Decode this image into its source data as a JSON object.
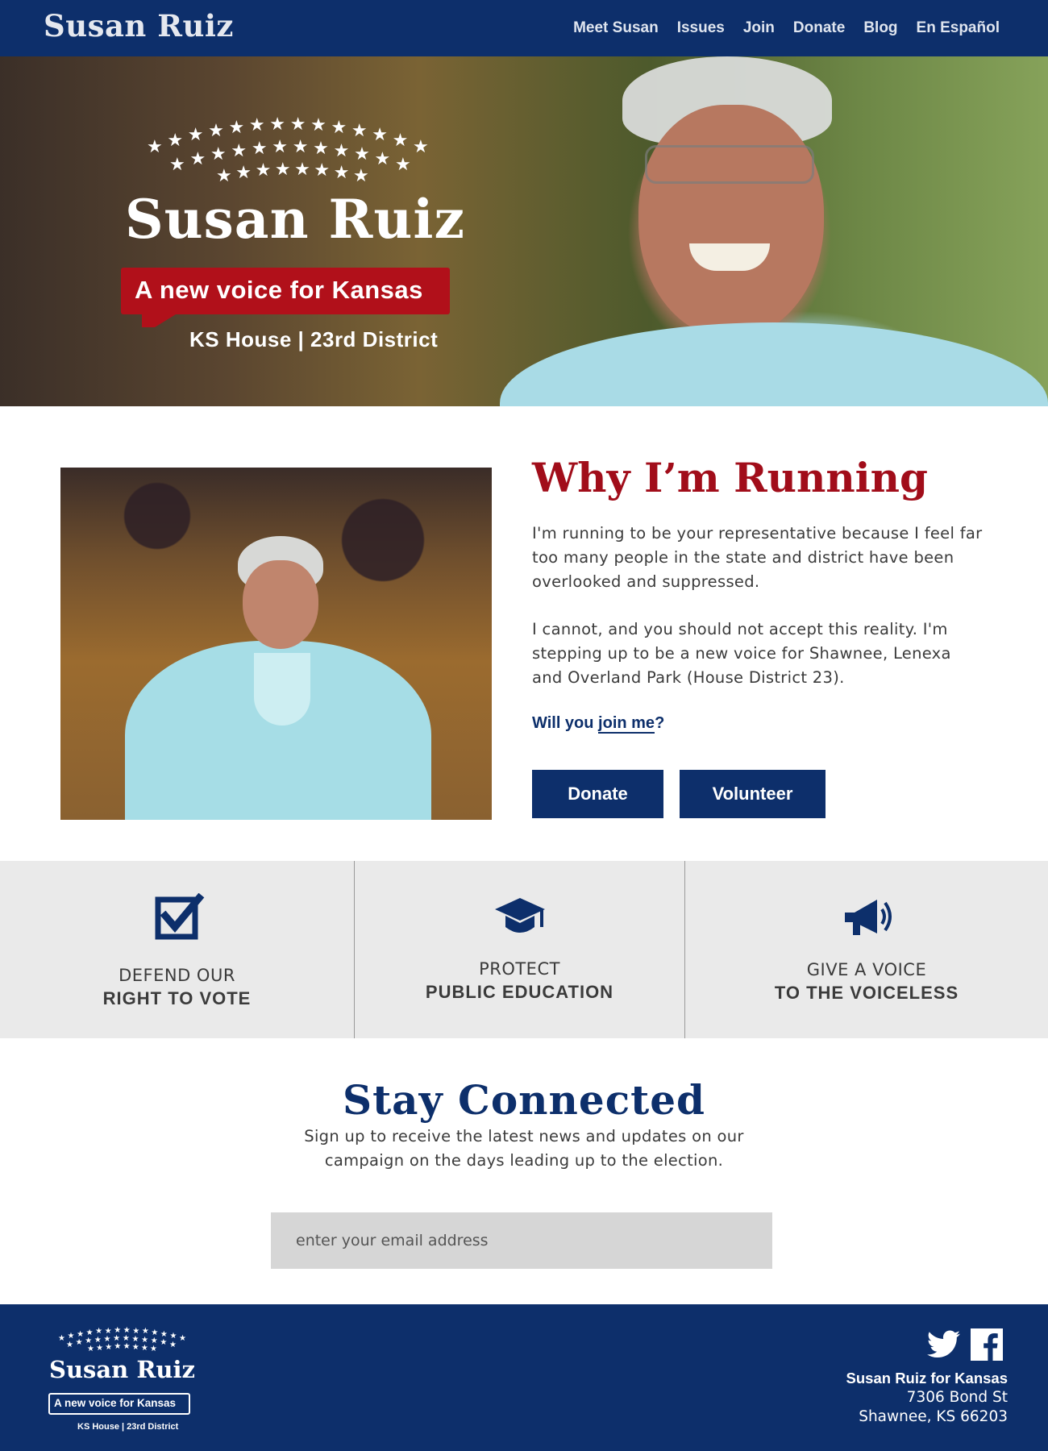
{
  "nav": {
    "brand": "Susan Ruiz",
    "items": [
      {
        "label": "Meet Susan"
      },
      {
        "label": "Issues"
      },
      {
        "label": "Join"
      },
      {
        "label": "Donate"
      },
      {
        "label": "Blog"
      },
      {
        "label": "En Español"
      }
    ]
  },
  "hero": {
    "name": "Susan Ruiz",
    "tagline": "A new voice for Kansas",
    "district": "KS House | 23rd District"
  },
  "why": {
    "title": "Why I’m Running",
    "p1": "I'm running to be your representative because I feel far too many people in the state and district have been overlooked and suppressed.",
    "p2": "I cannot, and you should not accept this reality.  I'm stepping up to be a new voice for Shawnee, Lenexa and Overland Park (House District 23).",
    "cta_prefix": "Will you ",
    "cta_link": "join me",
    "cta_suffix": "?",
    "donate_label": "Donate",
    "volunteer_label": "Volunteer"
  },
  "issues": [
    {
      "icon": "checkbox-icon",
      "line1": "DEFEND OUR",
      "line2": "RIGHT TO VOTE"
    },
    {
      "icon": "graduation-cap-icon",
      "line1": "PROTECT",
      "line2": "PUBLIC EDUCATION"
    },
    {
      "icon": "megaphone-icon",
      "line1": "GIVE A VOICE",
      "line2": "TO THE VOICELESS"
    }
  ],
  "stay": {
    "title": "Stay Connected",
    "text": "Sign up to receive the latest news and updates on our campaign on the days leading up to the election.",
    "email_placeholder": "enter your email address"
  },
  "footer": {
    "logo_name": "Susan Ruiz",
    "logo_tagline": "A new voice for Kansas",
    "logo_district": "KS House | 23rd District",
    "org": "Susan Ruiz for Kansas",
    "street": "7306 Bond St",
    "city": "Shawnee, KS  66203",
    "social": [
      "twitter-icon",
      "facebook-icon"
    ]
  },
  "colors": {
    "navy": "#0d2f6b",
    "red": "#a10d1a",
    "tag_red": "#b1101a",
    "issue_bg": "#eaeaea"
  }
}
